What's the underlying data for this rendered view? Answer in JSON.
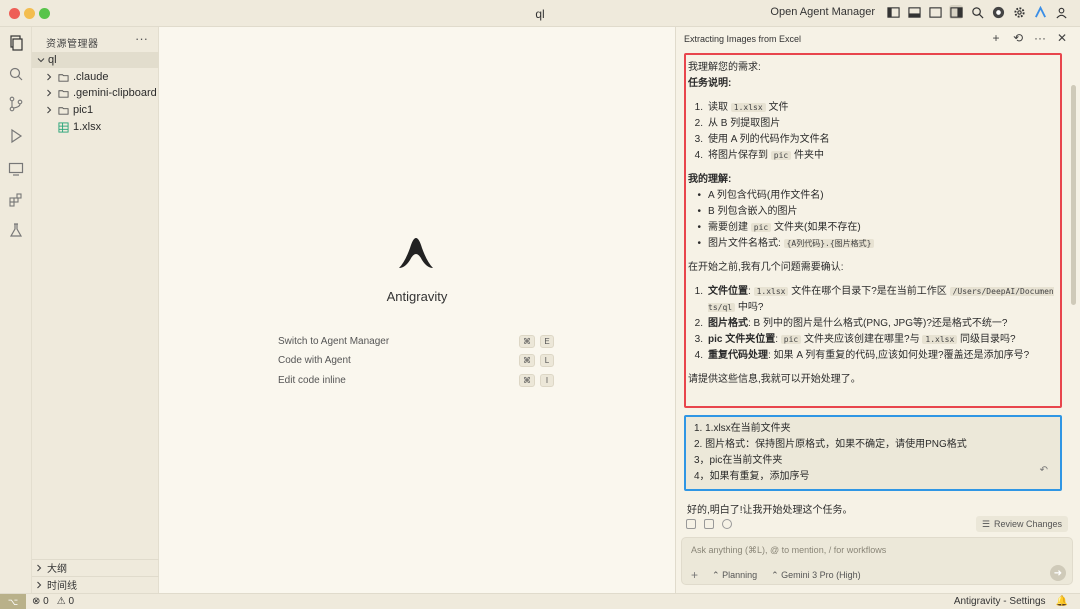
{
  "window": {
    "title": "ql"
  },
  "titlebar": {
    "open_agent_manager": "Open Agent Manager"
  },
  "explorer": {
    "header": "资源管理器",
    "more": "···",
    "root": "ql",
    "items": [
      {
        "name": ".claude",
        "type": "folder"
      },
      {
        "name": ".gemini-clipboard",
        "type": "folder"
      },
      {
        "name": "pic1",
        "type": "folder"
      },
      {
        "name": "1.xlsx",
        "type": "file"
      }
    ],
    "outline": "大纲",
    "timeline": "时间线"
  },
  "editor": {
    "app_name": "Antigravity",
    "shortcuts": [
      {
        "label": "Switch to Agent Manager",
        "keys": [
          "⌘",
          "E"
        ]
      },
      {
        "label": "Code with Agent",
        "keys": [
          "⌘",
          "L"
        ]
      },
      {
        "label": "Edit code inline",
        "keys": [
          "⌘",
          "I"
        ]
      }
    ]
  },
  "agent": {
    "title": "Extracting Images from Excel",
    "message": {
      "intro": "我理解您的需求:",
      "task_heading": "任务说明:",
      "tasks": [
        {
          "before": "读取 ",
          "code": "1.xlsx",
          "after": " 文件"
        },
        {
          "before": "从 B 列提取图片",
          "code": "",
          "after": ""
        },
        {
          "before": "使用 A 列的代码作为文件名",
          "code": "",
          "after": ""
        },
        {
          "before": "将图片保存到 ",
          "code": "pic",
          "after": " 件夹中"
        }
      ],
      "understanding_heading": "我的理解:",
      "understanding": [
        {
          "before": "A 列包含代码(用作文件名)",
          "code": "",
          "after": ""
        },
        {
          "before": "B 列包含嵌入的图片",
          "code": "",
          "after": ""
        },
        {
          "before": "需要创建 ",
          "code": "pic",
          "after": " 文件夹(如果不存在)"
        },
        {
          "before": "图片文件名格式: ",
          "code": "{A列代码}.{图片格式}",
          "after": ""
        }
      ],
      "question_intro": "在开始之前,我有几个问题需要确认:",
      "questions": [
        {
          "bold": "文件位置",
          "text1": ": ",
          "code1": "1.xlsx",
          "text2": " 文件在哪个目录下?是在当前工作区 ",
          "code2": "/Users/DeepAI/Documents/ql",
          "text3": " 中吗?"
        },
        {
          "bold": "图片格式",
          "text1": ": B 列中的图片是什么格式(PNG, JPG等)?还是格式不统一?",
          "code1": "",
          "text2": "",
          "code2": "",
          "text3": ""
        },
        {
          "bold": "pic 文件夹位置",
          "text1": ": ",
          "code1": "pic",
          "text2": " 文件夹应该创建在哪里?与 ",
          "code2": "1.xlsx",
          "text3": " 同级目录吗?"
        },
        {
          "bold": "重复代码处理",
          "text1": ": 如果 A 列有重复的代码,应该如何处理?覆盖还是添加序号?",
          "code1": "",
          "text2": "",
          "code2": "",
          "text3": ""
        }
      ],
      "closing": "请提供这些信息,我就可以开始处理了。"
    },
    "user_reply": [
      "1. 1.xlsx在当前文件夹",
      "2. 图片格式：保持图片原格式，如果不确定，请使用PNG格式",
      "3，pic在当前文件夹",
      "4，如果有重复，添加序号"
    ],
    "response": "好的,明白了!让我开始处理这个任务。",
    "review_changes": "Review Changes",
    "input_placeholder": "Ask anything (⌘L), @ to mention, / for workflows",
    "mode": "Planning",
    "model": "Gemini 3 Pro (High)"
  },
  "statusbar": {
    "errors": "0",
    "warnings": "0",
    "settings": "Antigravity - Settings"
  }
}
